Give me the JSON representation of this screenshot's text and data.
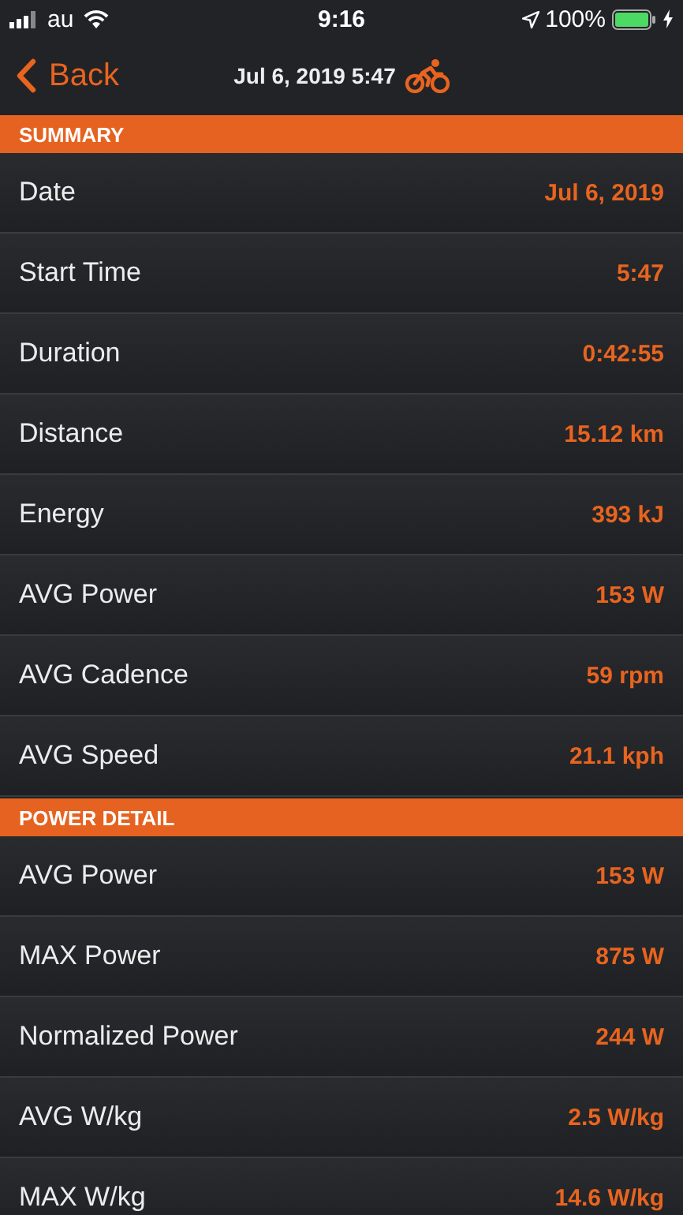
{
  "status_bar": {
    "carrier": "au",
    "time": "9:16",
    "battery": "100%"
  },
  "nav": {
    "back": "Back",
    "title": "Jul 6, 2019 5:47"
  },
  "sections": [
    {
      "title": "SUMMARY",
      "rows": [
        {
          "label": "Date",
          "value": "Jul 6, 2019"
        },
        {
          "label": "Start Time",
          "value": "5:47"
        },
        {
          "label": "Duration",
          "value": "0:42:55"
        },
        {
          "label": "Distance",
          "value": "15.12 km"
        },
        {
          "label": "Energy",
          "value": "393 kJ"
        },
        {
          "label": "AVG Power",
          "value": "153 W"
        },
        {
          "label": "AVG Cadence",
          "value": "59 rpm"
        },
        {
          "label": "AVG Speed",
          "value": "21.1 kph"
        }
      ]
    },
    {
      "title": "POWER DETAIL",
      "rows": [
        {
          "label": "AVG Power",
          "value": "153 W"
        },
        {
          "label": "MAX Power",
          "value": "875 W"
        },
        {
          "label": "Normalized Power",
          "value": "244 W"
        },
        {
          "label": "AVG W/kg",
          "value": "2.5 W/kg"
        },
        {
          "label": "MAX W/kg",
          "value": "14.6 W/kg"
        }
      ]
    }
  ]
}
